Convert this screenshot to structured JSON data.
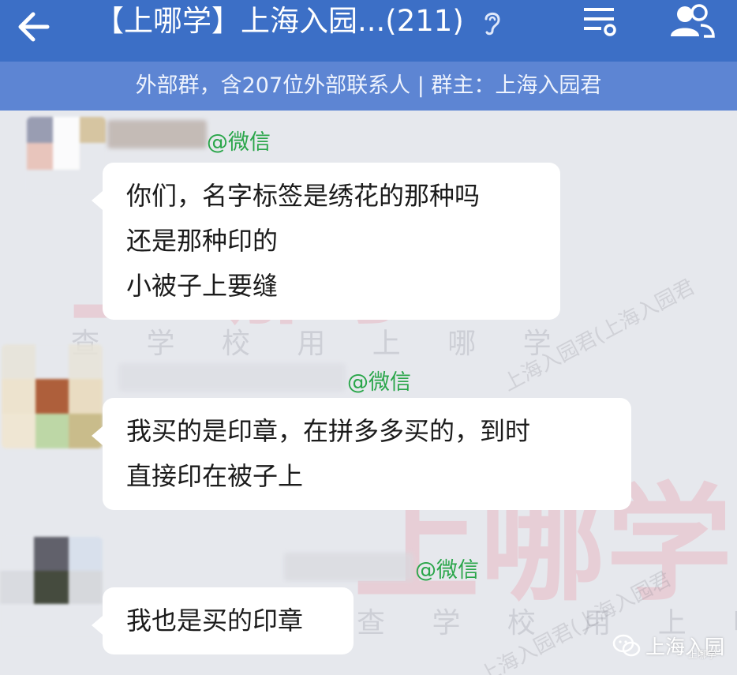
{
  "header": {
    "title": "【上哪学】上海入园...(211)",
    "subtitle": "外部群，含207位外部联系人 | 群主：上海入园君",
    "back_icon": "arrow-left-icon",
    "mute_icon": "ear-icon",
    "menu_icon": "menu-settings-icon",
    "members_icon": "group-members-icon"
  },
  "messages": [
    {
      "sender_suffix": "@微信",
      "lines": [
        "你们，名字标签是绣花的那种吗",
        "还是那种印的",
        "小被子上要缝"
      ]
    },
    {
      "sender_suffix": "@微信",
      "lines": [
        "我买的是印章，在拼多多买的，到时",
        "直接印在被子上"
      ]
    },
    {
      "sender_suffix": "@微信",
      "lines": [
        "我也是买的印章"
      ]
    }
  ],
  "watermarks": {
    "big": "上哪学",
    "small": "查 学 校  用 上 哪 学",
    "diagonal": "上海入园君(上海入园君",
    "brand": "上海入园",
    "brand_sub": "上哪学"
  },
  "colors": {
    "header_bg": "#3c6fc6",
    "subbar_bg": "#5d85d3",
    "chat_bg": "#e6e8ed",
    "sender_green": "#2aa64a",
    "watermark_pink": "#f05a6e"
  }
}
